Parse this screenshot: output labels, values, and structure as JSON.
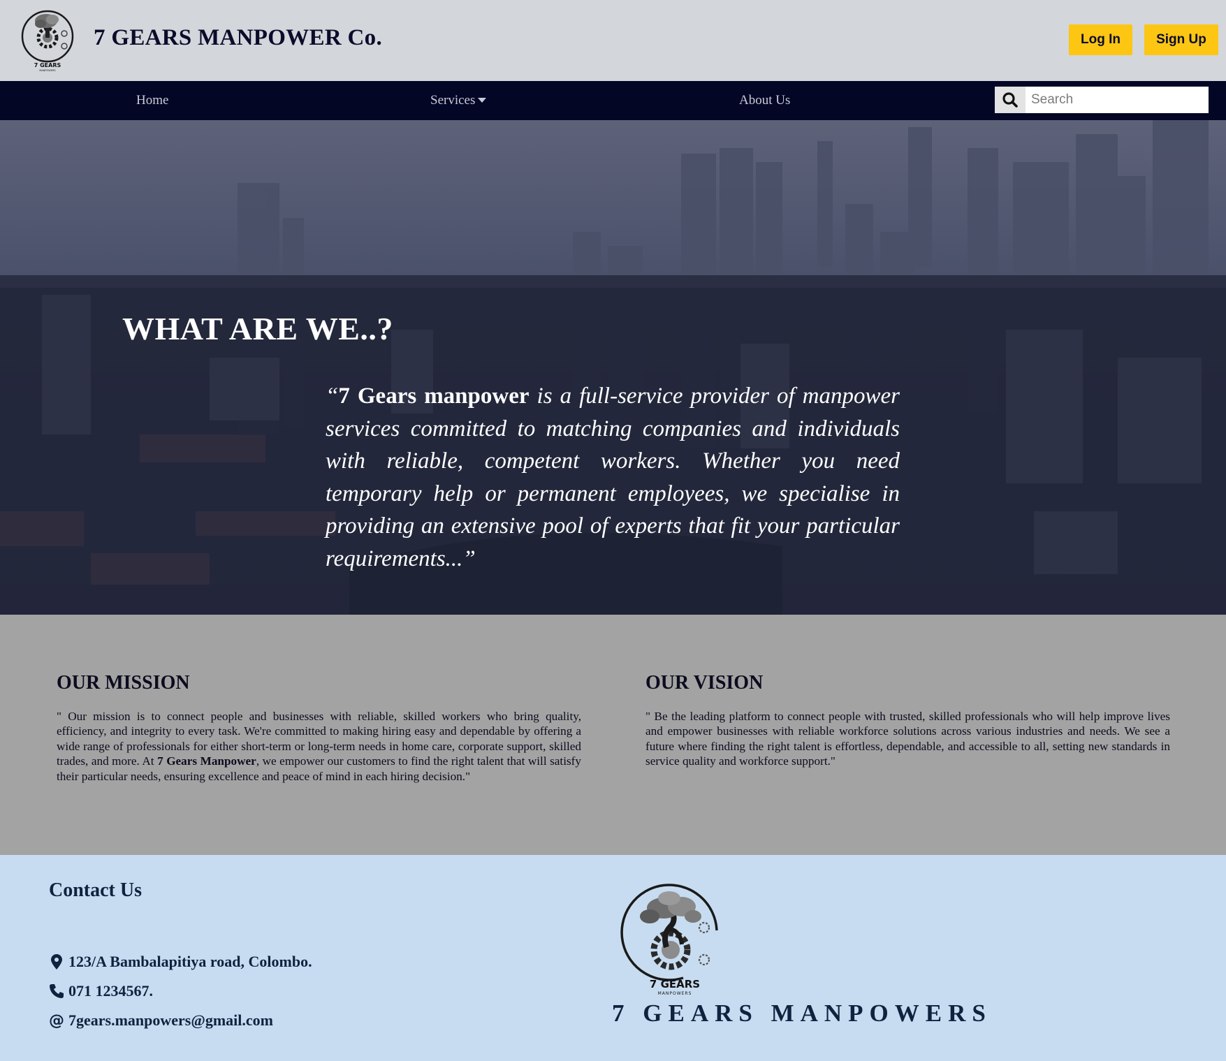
{
  "header": {
    "brand": "7 GEARS MANPOWER Co.",
    "logo_text": "7 GEARS",
    "logo_subtext": "MANPOWERS",
    "login_label": "Log In",
    "signup_label": "Sign Up",
    "accent_color": "#fcc613"
  },
  "nav": {
    "home": "Home",
    "services": "Services",
    "about": "About Us",
    "search_placeholder": "Search",
    "background_color": "#040626"
  },
  "hero": {
    "title": "WHAT ARE WE..?",
    "quote_open": "“",
    "quote_bold": "7 Gears manpower",
    "quote_text": " is a full-service provider of manpower services committed to matching companies and individuals with reliable, competent workers. Whether you need temporary help or permanent employees, we specialise in providing an extensive pool of experts that fit your particular requirements...”"
  },
  "mission": {
    "title": "OUR MISSION",
    "text_1": "\" Our mission is to connect people and businesses with reliable, skilled workers who bring quality, efficiency, and integrity to every task. We're committed to making hiring easy and dependable by offering a wide range of professionals for either short-term or long-term needs in home care, corporate support, skilled trades, and more. At ",
    "text_bold": "7 Gears Manpower",
    "text_2": ", we empower our customers to find the right talent that will satisfy their particular needs, ensuring excellence and peace of mind in each hiring decision.\""
  },
  "vision": {
    "title": "OUR VISION",
    "text": "\" Be the leading platform to connect people with trusted, skilled professionals who will help improve lives and empower businesses with reliable workforce solutions across various industries and needs. We see a future where finding the right talent is effortless, dependable, and accessible to all, setting new standards in service quality and workforce support.\""
  },
  "footer": {
    "contact_title": "Contact Us",
    "address": "123/A Bambalapitiya road, Colombo.",
    "phone": "071 1234567.",
    "email": "7gears.manpowers@gmail.com",
    "logo_text": "7 GEARS",
    "logo_subtext": "MANPOWERS",
    "brand": "7 GEARS MANPOWERS"
  }
}
